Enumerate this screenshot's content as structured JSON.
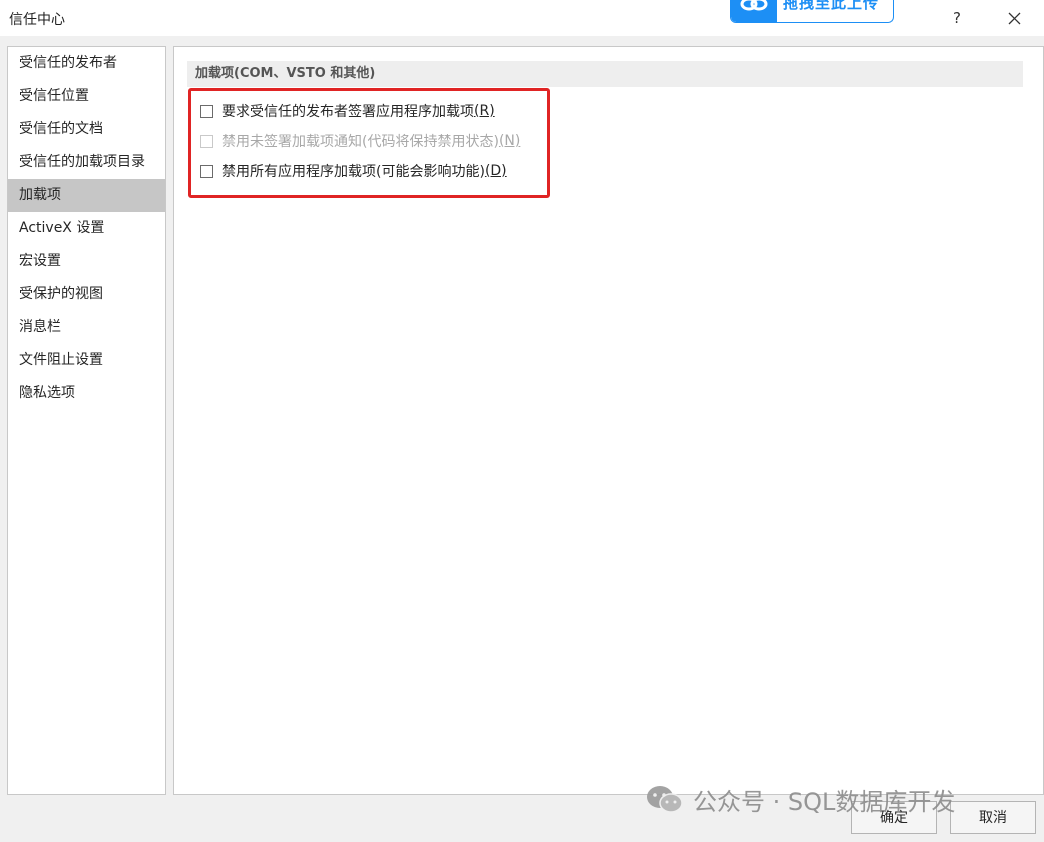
{
  "window": {
    "title": "信任中心",
    "help_label": "?"
  },
  "badge": {
    "text": "拖拽至此上传"
  },
  "sidebar": {
    "items": [
      {
        "label": "受信任的发布者"
      },
      {
        "label": "受信任位置"
      },
      {
        "label": "受信任的文档"
      },
      {
        "label": "受信任的加载项目录"
      },
      {
        "label": "加载项"
      },
      {
        "label": "ActiveX 设置"
      },
      {
        "label": "宏设置"
      },
      {
        "label": "受保护的视图"
      },
      {
        "label": "消息栏"
      },
      {
        "label": "文件阻止设置"
      },
      {
        "label": "隐私选项"
      }
    ],
    "selected": "加载项"
  },
  "main": {
    "section_title": "加载项(COM、VSTO 和其他)",
    "options": [
      {
        "text": "要求受信任的发布者签署应用程序加载项",
        "key_text": "(R)",
        "accel": "R",
        "checked": false,
        "enabled": true
      },
      {
        "text": "禁用未签署加载项通知(代码将保持禁用状态)",
        "key_text": "(N)",
        "accel": "N",
        "checked": false,
        "enabled": false
      },
      {
        "text": "禁用所有应用程序加载项(可能会影响功能)",
        "key_text": "(D)",
        "accel": "D",
        "checked": false,
        "enabled": true
      }
    ],
    "highlight_color": "#e02424"
  },
  "footer": {
    "ok_label": "确定",
    "cancel_label": "取消"
  },
  "watermark": {
    "text": "公众号 · SQL数据库开发"
  },
  "colors": {
    "accent": "#1d8ff5",
    "selected_bg": "#c6c6c6",
    "disabled_text": "#a8a8a8"
  }
}
